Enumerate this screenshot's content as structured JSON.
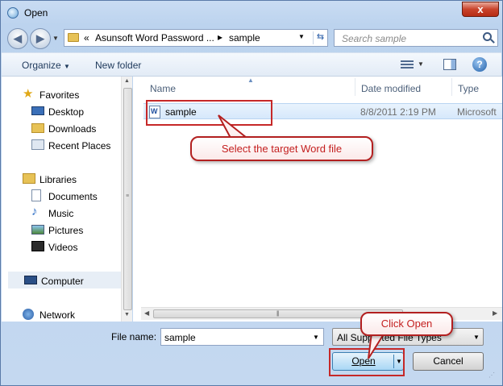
{
  "window": {
    "title": "Open",
    "close_symbol": "x"
  },
  "nav": {
    "back_symbol": "◀",
    "forward_symbol": "▶",
    "breadcrumb_prefix": "«",
    "breadcrumbs": [
      "Asunsoft Word Password ...",
      "sample"
    ],
    "search_placeholder": "Search sample"
  },
  "toolbar": {
    "organize_label": "Organize",
    "new_folder_label": "New folder",
    "help_symbol": "?"
  },
  "sidebar": {
    "items": [
      {
        "label": "Favorites",
        "icon": "star-icon"
      },
      {
        "label": "Desktop",
        "icon": "desktop-icon"
      },
      {
        "label": "Downloads",
        "icon": "downloads-folder-icon"
      },
      {
        "label": "Recent Places",
        "icon": "recent-places-icon"
      },
      {
        "label": "Libraries",
        "icon": "libraries-icon"
      },
      {
        "label": "Documents",
        "icon": "documents-icon"
      },
      {
        "label": "Music",
        "icon": "music-icon"
      },
      {
        "label": "Pictures",
        "icon": "pictures-icon"
      },
      {
        "label": "Videos",
        "icon": "videos-icon"
      },
      {
        "label": "Computer",
        "icon": "computer-icon"
      },
      {
        "label": "Network",
        "icon": "network-icon"
      }
    ]
  },
  "files": {
    "columns": [
      "Name",
      "Date modified",
      "Type"
    ],
    "rows": [
      {
        "name": "sample",
        "date": "8/8/2011 2:19 PM",
        "type": "Microsoft",
        "icon": "word-document-icon"
      }
    ]
  },
  "footer": {
    "filename_label": "File name:",
    "filename_value": "sample",
    "filter_value": "All Supported File Types",
    "open_label": "Open",
    "cancel_label": "Cancel"
  },
  "annotations": {
    "select_file": "Select the target Word file",
    "click_open": "Click Open",
    "color": "#c62828"
  }
}
